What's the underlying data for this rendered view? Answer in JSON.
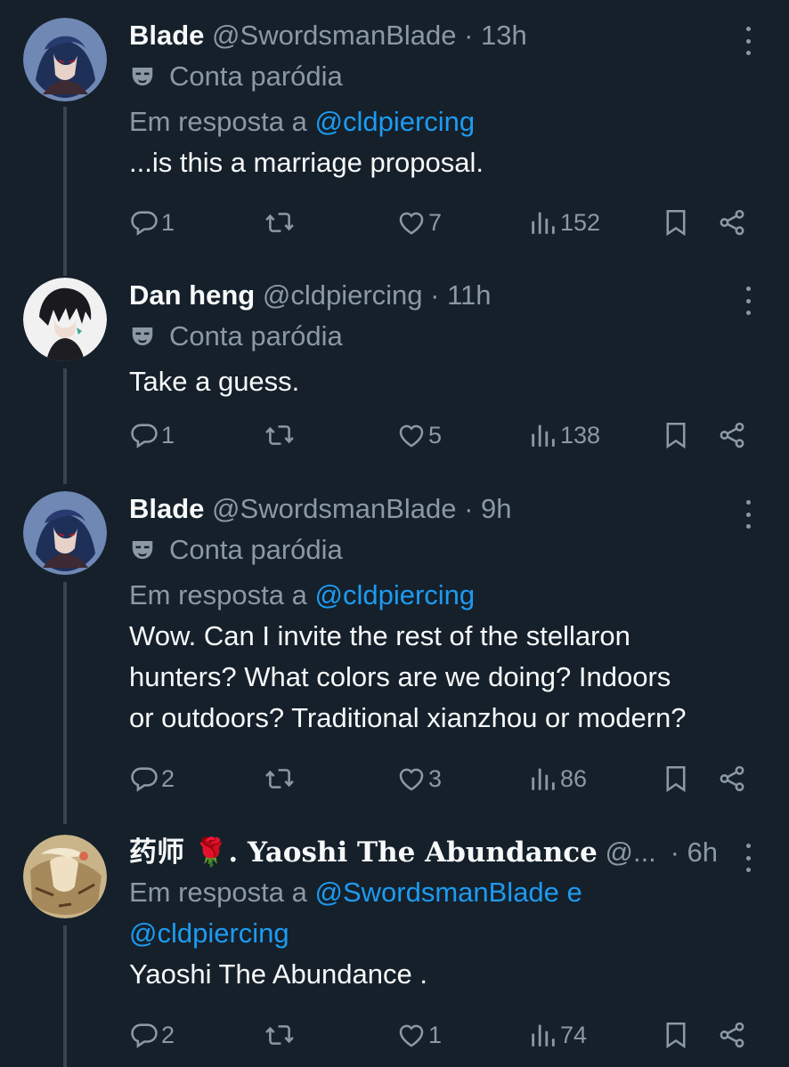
{
  "tweets": [
    {
      "name": "Blade",
      "handle": "@SwordsmanBlade",
      "sep": " · ",
      "time": "13h",
      "parody_label": "Conta paródia",
      "reply_prefix": "Em resposta a ",
      "reply_handle": "@cldpiercing",
      "text": "...is this a marriage proposal.",
      "replies": "1",
      "retweets": "",
      "likes": "7",
      "views": "152"
    },
    {
      "name": "Dan heng",
      "handle": "@cldpiercing",
      "sep": " · ",
      "time": "11h",
      "parody_label": "Conta paródia",
      "text": "Take a guess.",
      "replies": "1",
      "retweets": "",
      "likes": "5",
      "views": "138"
    },
    {
      "name": "Blade",
      "handle": "@SwordsmanBlade",
      "sep": " · ",
      "time": "9h",
      "parody_label": "Conta paródia",
      "reply_prefix": "Em resposta a ",
      "reply_handle": "@cldpiercing",
      "text_lines": [
        "Wow. Can I invite the rest of the stellaron",
        "hunters? What colors are we doing? Indoors",
        "or outdoors? Traditional xianzhou or modern?"
      ],
      "replies": "2",
      "retweets": "",
      "likes": "3",
      "views": "86"
    },
    {
      "name": "药师 🌹. Yaoshi The Abundance",
      "handle": "@...",
      "sep": " · ",
      "time": "6h",
      "reply_prefix": "Em resposta a ",
      "reply_handle": "@SwordsmanBlade e",
      "reply_handle2": "@cldpiercing",
      "text": "Yaoshi The Abundance .",
      "replies": "2",
      "retweets": "",
      "likes": "1",
      "views": "74"
    }
  ],
  "colors": {
    "background": "#15202b",
    "text": "#f7f9f9",
    "secondary": "#8b98a5",
    "link": "#1d9bf0",
    "thread_line": "#38444d"
  },
  "icons": [
    "more-icon",
    "parody-mask-icon",
    "reply-icon",
    "retweet-icon",
    "like-icon",
    "views-icon",
    "bookmark-icon",
    "share-icon"
  ]
}
